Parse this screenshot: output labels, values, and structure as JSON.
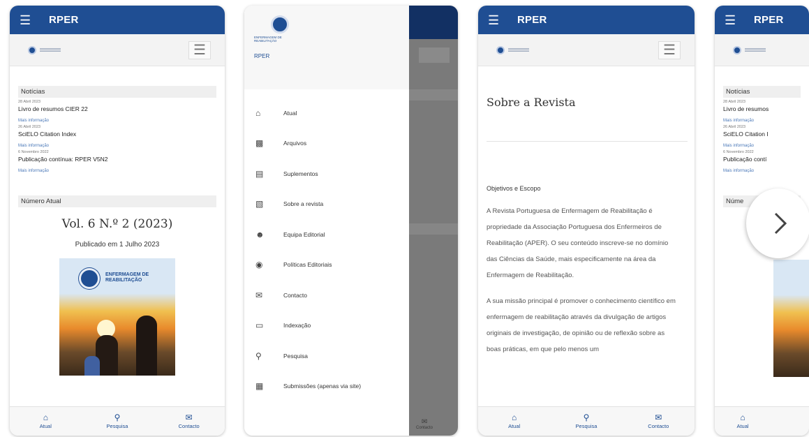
{
  "app": {
    "title": "RPER"
  },
  "phone1": {
    "news_heading": "Notícias",
    "news": [
      {
        "date": "28 Abril 2023",
        "title": "Livro de resumos CIER 22",
        "more": "Mais informação"
      },
      {
        "date": "26 Abril 2023",
        "title": "SciELO Citation Index",
        "more": "Mais informação"
      },
      {
        "date": "6 Novembro 2022",
        "title": "Publicação contínua: RPER V5N2",
        "more": "Mais informação"
      }
    ],
    "issue_heading": "Número Atual",
    "issue": "Vol. 6 N.º 2 (2023)",
    "published": "Publicado em 1 Julho 2023",
    "cover_title_1": "ENFERMAGEM DE",
    "cover_title_2": "REABILITAÇÃO"
  },
  "bottom_nav": [
    {
      "icon": "home-icon",
      "label": "Atual"
    },
    {
      "icon": "search-icon",
      "label": "Pesquisa"
    },
    {
      "icon": "mail-icon",
      "label": "Contacto"
    }
  ],
  "drawer": {
    "logo_text_1": "ENFERMAGEM DE",
    "logo_text_2": "REABILITAÇÃO",
    "title": "RPER",
    "items": [
      {
        "icon": "home-icon",
        "label": "Atual"
      },
      {
        "icon": "archive-icon",
        "label": "Arquivos"
      },
      {
        "icon": "supplements-icon",
        "label": "Suplementos"
      },
      {
        "icon": "book-icon",
        "label": "Sobre a revista"
      },
      {
        "icon": "person-icon",
        "label": "Equipa Editorial"
      },
      {
        "icon": "shield-icon",
        "label": "Políticas Editoriais"
      },
      {
        "icon": "mail-icon",
        "label": "Contacto"
      },
      {
        "icon": "laptop-icon",
        "label": "Indexação"
      },
      {
        "icon": "search-icon",
        "label": "Pesquisa"
      },
      {
        "icon": "submit-icon",
        "label": "Submissões (apenas via site)"
      }
    ],
    "scrim_contact": "Contacto"
  },
  "phone3": {
    "title": "Sobre a Revista",
    "heading": "Objetivos e Escopo",
    "paragraph1": "A Revista Portuguesa de Enfermagem de Reabilitação é propriedade da Associação Portuguesa dos Enfermeiros de Reabilitação (APER). O seu conteúdo inscreve-se no domínio das Ciências da Saúde, mais especificamente na área da Enfermagem de Reabilitação.",
    "paragraph2": "A sua missão principal é promover o conhecimento científico em enfermagem de reabilitação através da divulgação de artigos originais de investigação, de opinião ou de reflexão sobre as boas práticas, em que pelo menos um"
  },
  "phone4": {
    "title": "RPER",
    "news_heading": "Notícias",
    "news": [
      {
        "date": "28 Abril 2023",
        "title": "Livro de resumos",
        "more": "Mais informação"
      },
      {
        "date": "26 Abril 2023",
        "title": "SciELO Citation I",
        "more": "Mais informação"
      },
      {
        "date": "6 Novembro 2022",
        "title": "Publicação contí",
        "more": "Mais informação"
      }
    ],
    "issue_heading": "Núme",
    "published": "Pul",
    "nav_label": "Atual"
  },
  "carousel": {
    "next_icon": "chevron-right-icon"
  }
}
